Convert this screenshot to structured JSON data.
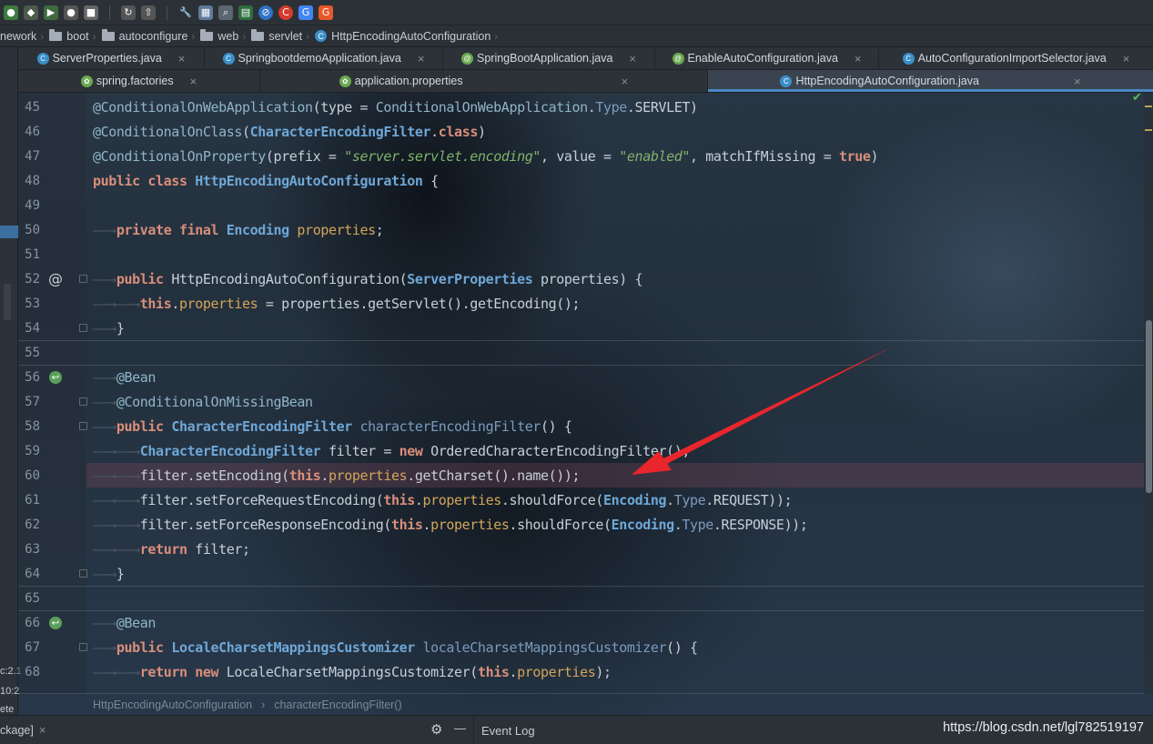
{
  "breadcrumb": [
    "nework",
    "boot",
    "autoconfigure",
    "web",
    "servlet",
    "HttpEncodingAutoConfiguration"
  ],
  "tabs_row1": [
    {
      "label": "ServerProperties.java",
      "icon": "class-icon"
    },
    {
      "label": "SpringbootdemoApplication.java",
      "icon": "class-icon"
    },
    {
      "label": "SpringBootApplication.java",
      "icon": "annotation-icon"
    },
    {
      "label": "EnableAutoConfiguration.java",
      "icon": "annotation-icon"
    },
    {
      "label": "AutoConfigurationImportSelector.java",
      "icon": "class-icon"
    }
  ],
  "tabs_row2": [
    {
      "label": "spring.factories",
      "icon": "spring-icon"
    },
    {
      "label": "application.properties",
      "icon": "spring-icon"
    },
    {
      "label": "HttpEncodingAutoConfiguration.java",
      "icon": "class-icon",
      "active": true
    }
  ],
  "left_strip": {
    "a": "c:2.1",
    "b": "10:2",
    "c": "ete",
    "d": "ckage]"
  },
  "code": {
    "line_numbers": [
      "45",
      "46",
      "47",
      "48",
      "49",
      "50",
      "51",
      "52",
      "53",
      "54",
      "55",
      "56",
      "57",
      "58",
      "59",
      "60",
      "61",
      "62",
      "63",
      "64",
      "65",
      "66",
      "67",
      "68"
    ],
    "l45_ann": "@ConditionalOnWebApplication",
    "l45_a": "(type = ",
    "l45_b": "ConditionalOnWebApplication",
    "l45_c": ".",
    "l45_d": "Type",
    "l45_e": ".SERVLET)",
    "l46_ann": "@ConditionalOnClass",
    "l46_a": "(",
    "l46_b": "CharacterEncodingFilter",
    "l46_c": ".",
    "l46_d": "class",
    "l46_e": ")",
    "l47_ann": "@ConditionalOnProperty",
    "l47_a": "(prefix = ",
    "l47_b": "\"server.servlet.encoding\"",
    "l47_c": ", value = ",
    "l47_d": "\"enabled\"",
    "l47_e": ", matchIfMissing = ",
    "l47_f": "true",
    "l47_g": ")",
    "l48_a": "public class ",
    "l48_b": "HttpEncodingAutoConfiguration",
    "l48_c": " {",
    "l50_a": "private final ",
    "l50_b": "Encoding",
    "l50_c": " properties",
    "l50_d": ";",
    "l52_a": "public ",
    "l52_b": "HttpEncodingAutoConfiguration(",
    "l52_c": "ServerProperties",
    "l52_d": " properties) {",
    "l53_a": "this",
    "l53_b": ".",
    "l53_c": "properties",
    "l53_d": " = properties.getServlet().getEncoding();",
    "l54_a": "}",
    "l56_a": "@Bean",
    "l57_a": "@ConditionalOnMissingBean",
    "l58_a": "public ",
    "l58_b": "CharacterEncodingFilter",
    "l58_c": " characterEncodingFilter",
    "l58_d": "() {",
    "l59_a": "CharacterEncodingFilter",
    "l59_b": " filter = ",
    "l59_c": "new ",
    "l59_d": "OrderedCharacterEncodingFilter();",
    "l60_a": "filter.setEncoding(",
    "l60_b": "this",
    "l60_c": ".",
    "l60_d": "properties",
    "l60_e": ".getCharset().name());",
    "l61_a": "filter.setForceRequestEncoding(",
    "l61_b": "this",
    "l61_c": ".",
    "l61_d": "properties",
    "l61_e": ".shouldForce(",
    "l61_f": "Encoding",
    "l61_g": ".",
    "l61_h": "Type",
    "l61_i": ".REQUEST));",
    "l62_a": "filter.setForceResponseEncoding(",
    "l62_b": "this",
    "l62_c": ".",
    "l62_d": "properties",
    "l62_e": ".shouldForce(",
    "l62_f": "Encoding",
    "l62_g": ".",
    "l62_h": "Type",
    "l62_i": ".RESPONSE));",
    "l63_a": "return ",
    "l63_b": "filter;",
    "l64_a": "}",
    "l66_a": "@Bean",
    "l67_a": "public ",
    "l67_b": "LocaleCharsetMappingsCustomizer",
    "l67_c": " localeCharsetMappingsCustomizer",
    "l67_d": "() {",
    "l68_a": "return ",
    "l68_b": "new ",
    "l68_c": "LocaleCharsetMappingsCustomizer(",
    "l68_d": "this",
    "l68_e": ".",
    "l68_f": "properties",
    "l68_g": ");"
  },
  "editor_breadcrumb": {
    "class": "HttpEncodingAutoConfiguration",
    "sep": "›",
    "method": "characterEncodingFilter()"
  },
  "bottom": {
    "event_log": "Event Log"
  },
  "watermark": "https://blog.csdn.net/lgl782519197",
  "colors": {
    "accent": "#4a88c7",
    "arrow": "#e8262b"
  }
}
